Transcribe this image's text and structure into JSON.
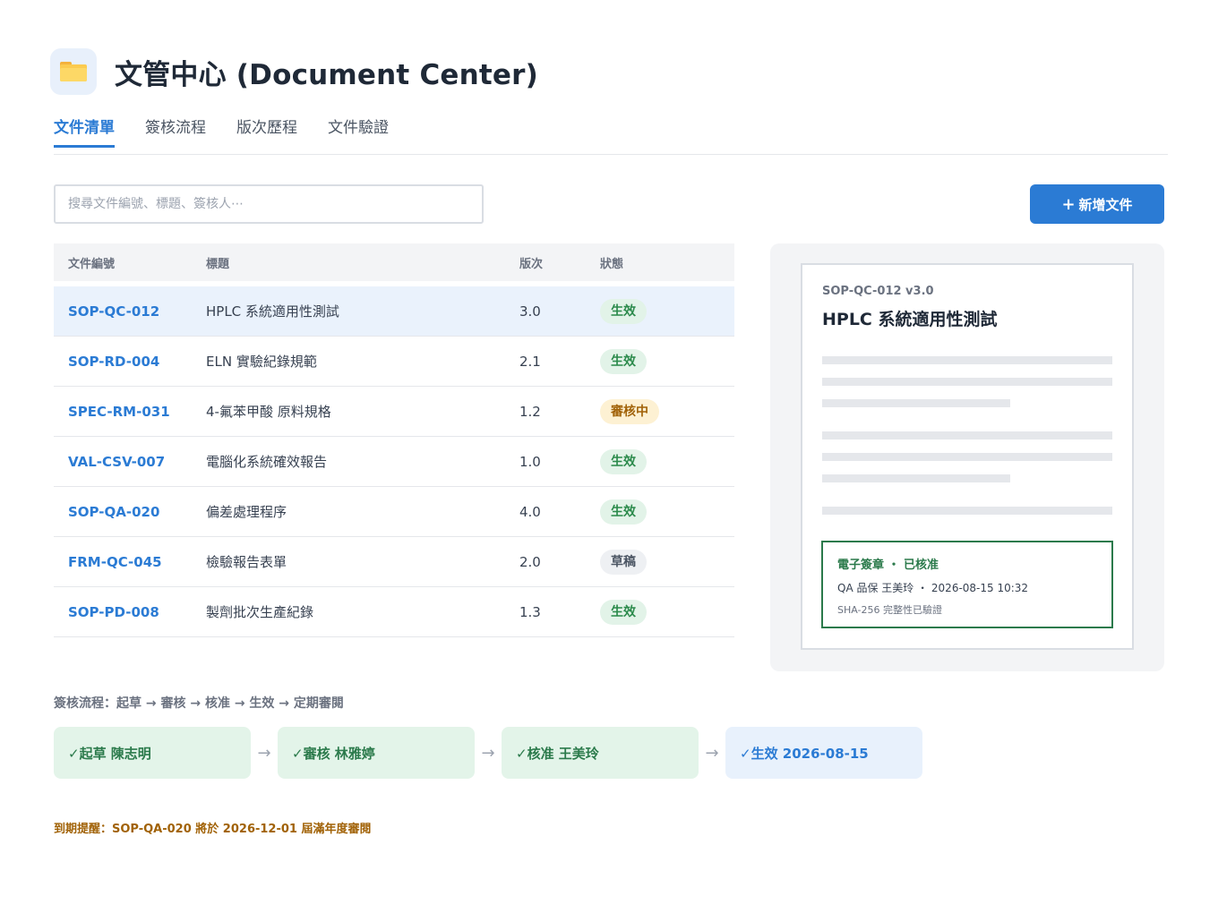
{
  "header": {
    "title": "文管中心 (Document Center)",
    "icon": "folder-icon"
  },
  "tabs": [
    {
      "label": "文件清單",
      "active": true
    },
    {
      "label": "簽核流程",
      "active": false
    },
    {
      "label": "版次歷程",
      "active": false
    },
    {
      "label": "文件驗證",
      "active": false
    }
  ],
  "search": {
    "placeholder": "搜尋文件編號、標題、簽核人⋯",
    "value": ""
  },
  "toolbar": {
    "new_label": "新增文件",
    "new_icon": "plus-icon"
  },
  "table": {
    "columns": [
      "文件編號",
      "標題",
      "版次",
      "狀態"
    ],
    "rows": [
      {
        "id": "SOP-QC-012",
        "title": "HPLC 系統適用性測試",
        "version": "3.0",
        "status": "生效",
        "tone": "green",
        "selected": true
      },
      {
        "id": "SOP-RD-004",
        "title": "ELN 實驗紀錄規範",
        "version": "2.1",
        "status": "生效",
        "tone": "green"
      },
      {
        "id": "SPEC-RM-031",
        "title": "4-氟苯甲酸 原料規格",
        "version": "1.2",
        "status": "審核中",
        "tone": "amber"
      },
      {
        "id": "VAL-CSV-007",
        "title": "電腦化系統確效報告",
        "version": "1.0",
        "status": "生效",
        "tone": "green"
      },
      {
        "id": "SOP-QA-020",
        "title": "偏差處理程序",
        "version": "4.0",
        "status": "生效",
        "tone": "green"
      },
      {
        "id": "FRM-QC-045",
        "title": "檢驗報告表單",
        "version": "2.0",
        "status": "草稿",
        "tone": "gray"
      },
      {
        "id": "SOP-PD-008",
        "title": "製劑批次生產紀錄",
        "version": "1.3",
        "status": "生效",
        "tone": "green"
      }
    ]
  },
  "preview": {
    "meta": "SOP-QC-012  v3.0",
    "title": "HPLC 系統適用性測試",
    "signature": {
      "title": "電子簽章 ・ 已核准",
      "by": "QA 品保 王美玲 ・ 2026-08-15 10:32",
      "hash": "SHA-256 完整性已驗證"
    }
  },
  "workflow": {
    "caption": "簽核流程：起草 → 審核 → 核准 → 生效 → 定期審閱",
    "steps": [
      {
        "label": "✓起草  陳志明",
        "state": "done"
      },
      {
        "label": "✓審核  林雅婷",
        "state": "done"
      },
      {
        "label": "✓核准  王美玲",
        "state": "done"
      },
      {
        "label": "✓生效  2026-08-15",
        "state": "current"
      }
    ],
    "arrow": "→"
  },
  "reminder": "到期提醒：SOP-QA-020 將於 2026-12-01 屆滿年度審閱",
  "colors": {
    "accent": "#2b7bd4",
    "success": "#2b7a4b",
    "warning": "#a16207"
  }
}
